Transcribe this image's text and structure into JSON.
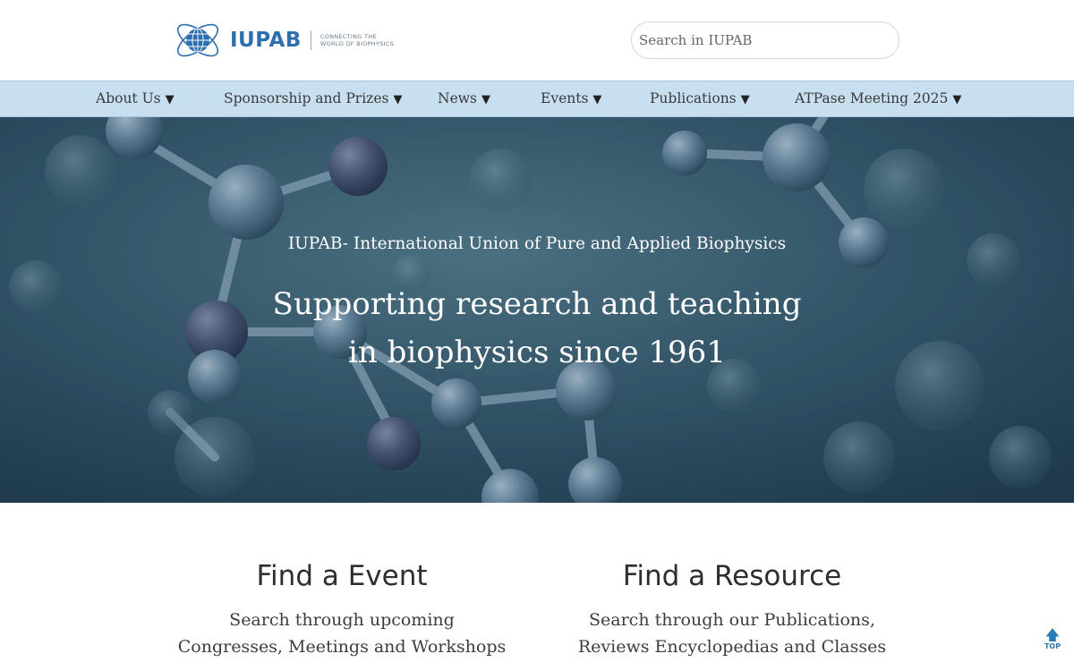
{
  "header": {
    "logo_text": "IUPAB",
    "logo_tagline_line1": "CONNECTING THE",
    "logo_tagline_line2": "WORLD OF BIOPHYSICS",
    "search_placeholder": "Search in IUPAB"
  },
  "nav": {
    "items": [
      {
        "label": "About Us",
        "icon": "caret-down"
      },
      {
        "label": "Sponsorship and Prizes",
        "icon": "caret-down"
      },
      {
        "label": "News",
        "icon": "caret-down"
      },
      {
        "label": "Events",
        "icon": "caret-down"
      },
      {
        "label": "Publications",
        "icon": "caret-down"
      },
      {
        "label": "ATPase Meeting 2025",
        "icon": "caret-down"
      }
    ],
    "caret": "▼"
  },
  "hero": {
    "overline": "IUPAB- International Union of Pure and Applied Biophysics",
    "title_line1": "Supporting research and teaching",
    "title_line2": "in biophysics since 1961"
  },
  "cards": [
    {
      "title": "Find a Event",
      "line1": "Search through upcoming",
      "line2": "Congresses, Meetings and Workshops"
    },
    {
      "title": "Find a Resource",
      "line1": "Search through our Publications,",
      "line2": "Reviews Encyclopedias and Classes"
    }
  ],
  "top_button": {
    "label": "TOP",
    "arrow": "🡅"
  },
  "colors": {
    "brand_blue": "#2d6fae",
    "nav_bg": "#c8dff0",
    "hero_overlay": "#2a4656"
  }
}
